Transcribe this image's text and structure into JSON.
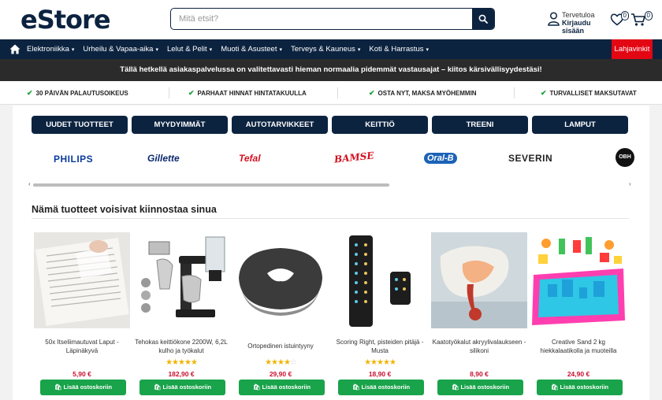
{
  "header": {
    "logo": "eStore",
    "search_placeholder": "Mitä etsit?",
    "user_greeting": "Tervetuloa",
    "user_login": "Kirjaudu sisään",
    "wishlist_count": "0",
    "cart_count": "0"
  },
  "nav": {
    "items": [
      {
        "label": "Elektroniikka"
      },
      {
        "label": "Urheilu & Vapaa-aika"
      },
      {
        "label": "Lelut & Pelit"
      },
      {
        "label": "Muoti & Asusteet"
      },
      {
        "label": "Terveys & Kauneus"
      },
      {
        "label": "Koti & Harrastus"
      }
    ],
    "gift_label": "Lahjavinkit"
  },
  "notice": "Tällä hetkellä asiakaspalvelussa on valitettavasti hieman normaalia pidemmät vastausajat – kiitos kärsivällisyydestäsi!",
  "usps": [
    "30 PÄIVÄN PALAUTUSOIKEUS",
    "PARHAAT HINNAT HINTATAKUULLA",
    "OSTA NYT, MAKSA MYÖHEMMIN",
    "TURVALLISET MAKSUTAVAT"
  ],
  "categories": [
    "UUDET TUOTTEET",
    "MYYDYIMMÄT",
    "AUTOTARVIKKEET",
    "KEITTIÖ",
    "TREENI",
    "LAMPUT"
  ],
  "brands": [
    "PHILIPS",
    "Gillette",
    "Tefal",
    "BAMSE",
    "Oral-B",
    "SEVERIN",
    "OBH"
  ],
  "section_title": "Nämä tuotteet voisivat kiinnostaa sinua",
  "add_to_cart_label": "Lisää ostoskoriin",
  "products": [
    {
      "name": "50x Itseliimautuvat Laput - Läpinäkyvä",
      "price": "5,90 €",
      "rating": 0
    },
    {
      "name": "Tehokas keittiökone 2200W, 6,2L kulho ja työkalut",
      "price": "182,90 €",
      "rating": 5
    },
    {
      "name": "Ortopedinen istuintyyny",
      "price": "29,90 €",
      "rating": 4
    },
    {
      "name": "Scoring Right, pisteiden pitäjä - Musta",
      "price": "18,90 €",
      "rating": 5
    },
    {
      "name": "Kaatotyökalut akryylivalaukseen - silikoni",
      "price": "8,90 €",
      "rating": 0
    },
    {
      "name": "Creative Sand 2 kg hiekkalaatikolla ja muoteilla",
      "price": "24,90 €",
      "rating": 0
    }
  ],
  "colors": {
    "navy": "#0c2340",
    "red": "#e30613",
    "green": "#19a34a",
    "star": "#f1b400",
    "price": "#c8102e"
  }
}
